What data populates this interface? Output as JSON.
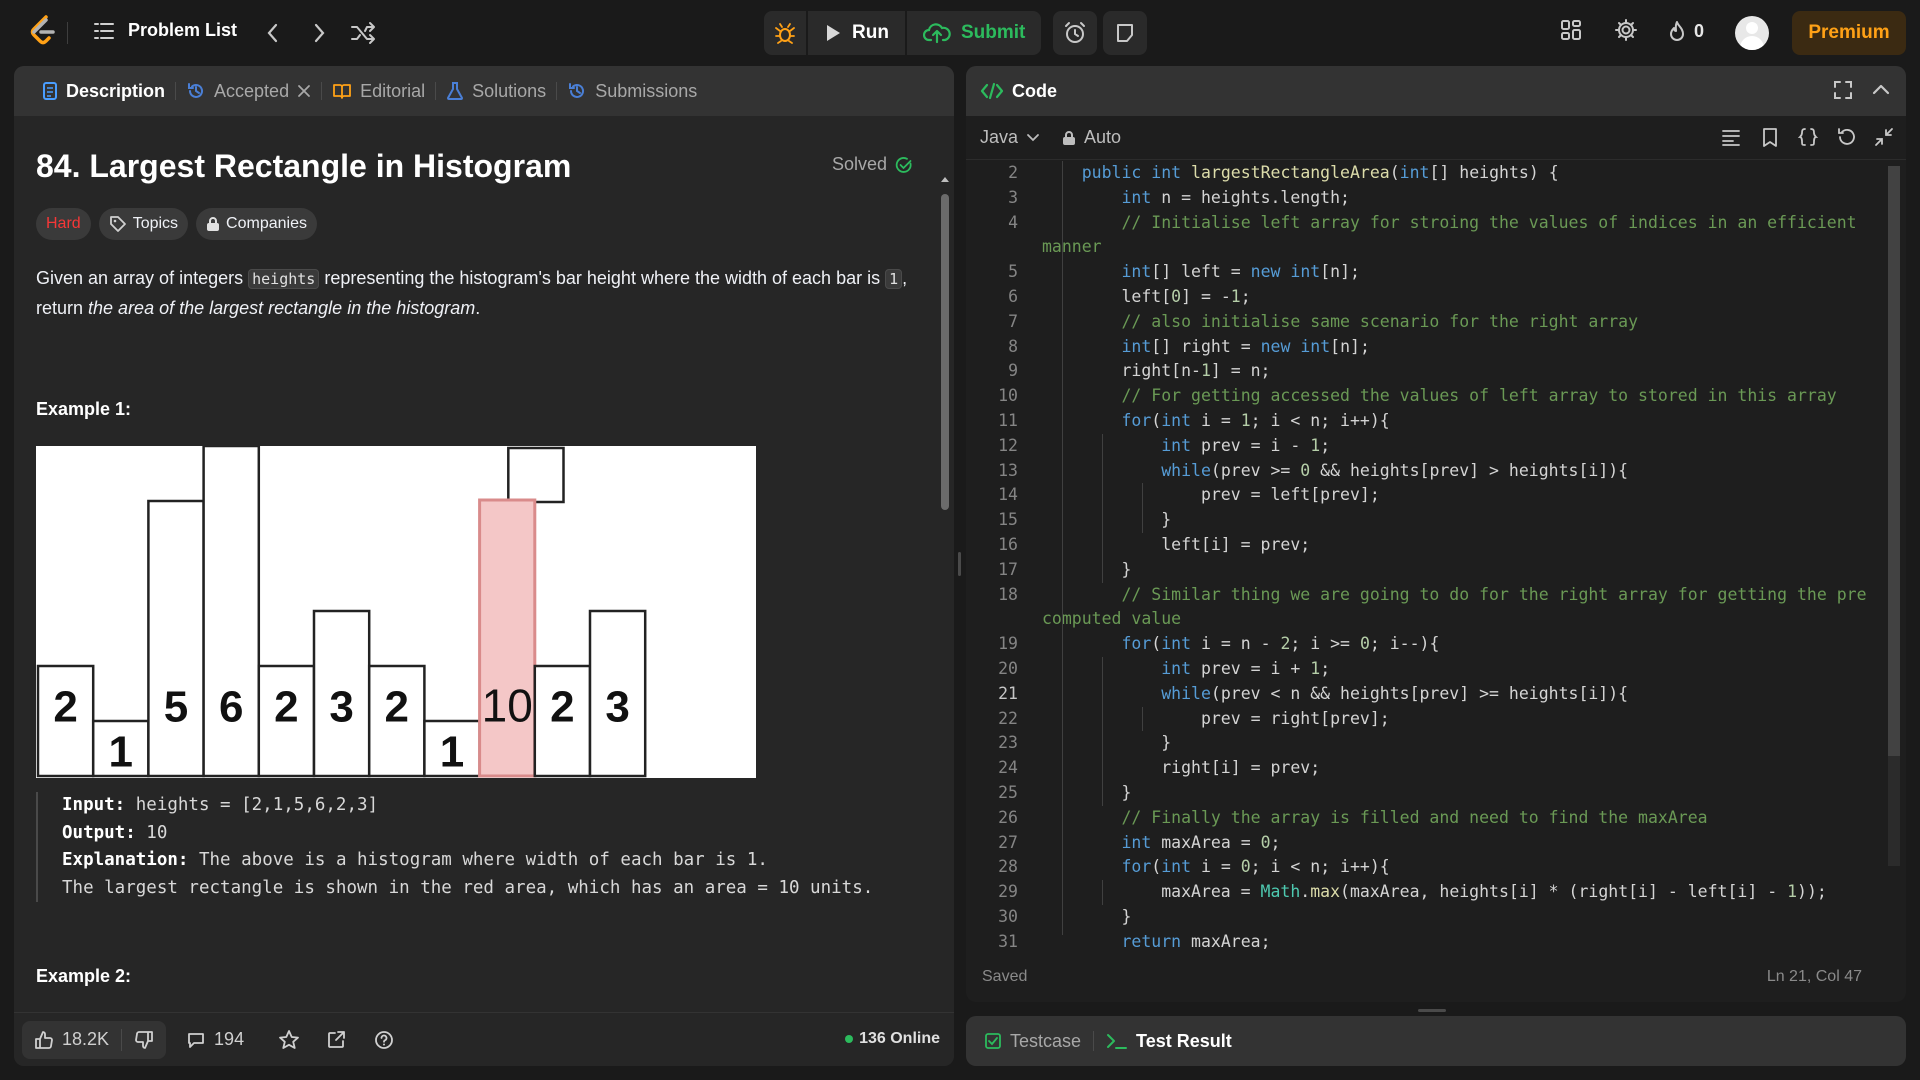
{
  "colors": {
    "accent": "#ffa116",
    "success": "#2cbb5d",
    "hard": "#f63737",
    "highlight": "#f4c7c7"
  },
  "topbar": {
    "problem_list": "Problem List",
    "run": "Run",
    "submit": "Submit",
    "streak": "0",
    "premium": "Premium"
  },
  "left": {
    "tabs": [
      "Description",
      "Accepted",
      "Editorial",
      "Solutions",
      "Submissions"
    ],
    "title": "84. Largest Rectangle in Histogram",
    "status": "Solved",
    "chips": [
      "Hard",
      "Topics",
      "Companies"
    ],
    "desc": {
      "p1": "Given an array of integers ",
      "code1": "heights",
      "p2": " representing the histogram's bar height where the width of each bar is ",
      "code2": "1",
      "p3": ", return ",
      "em": "the area of the largest rectangle in the histogram",
      "p4": "."
    },
    "example1": "Example 1:",
    "example2": "Example 2:",
    "histogram": {
      "bars": [
        2,
        1,
        5,
        6,
        2,
        3,
        2,
        1,
        10,
        2,
        3
      ]
    },
    "ex1": {
      "input_label": "Input:",
      "input": " heights = [2,1,5,6,2,3]",
      "output_label": "Output:",
      "output": " 10",
      "expl_label": "Explanation:",
      "expl": " The above is a histogram where width of each bar is 1.\nThe largest rectangle is shown in the red area, which has an area = 10 units."
    },
    "footer": {
      "likes": "18.2K",
      "comments": "194",
      "online": "136 Online"
    }
  },
  "right": {
    "title": "Code",
    "language": "Java",
    "mode": "Auto",
    "saved": "Saved",
    "cursor": "Ln 21, Col 47",
    "tabs": [
      "Testcase",
      "Test Result"
    ]
  },
  "code_lines": [
    {
      "n": "2",
      "t": "    public int largestRectangleArea(int[] heights) {"
    },
    {
      "n": "3",
      "t": "        int n = heights.length;"
    },
    {
      "n": "4",
      "t": "        // Initialise left array for stroing the values of indices in an efficient"
    },
    {
      "n": "",
      "t": "manner"
    },
    {
      "n": "5",
      "t": "        int[] left = new int[n];"
    },
    {
      "n": "6",
      "t": "        left[0] = -1;"
    },
    {
      "n": "7",
      "t": "        // also initialise same scenario for the right array"
    },
    {
      "n": "8",
      "t": "        int[] right = new int[n];"
    },
    {
      "n": "9",
      "t": "        right[n-1] = n;"
    },
    {
      "n": "10",
      "t": "        // For getting accessed the values of left array to stored in this array"
    },
    {
      "n": "11",
      "t": "        for(int i = 1; i < n; i++){"
    },
    {
      "n": "12",
      "t": "            int prev = i - 1;"
    },
    {
      "n": "13",
      "t": "            while(prev >= 0 && heights[prev] > heights[i]){"
    },
    {
      "n": "14",
      "t": "                prev = left[prev];"
    },
    {
      "n": "15",
      "t": "            }"
    },
    {
      "n": "16",
      "t": "            left[i] = prev;"
    },
    {
      "n": "17",
      "t": "        }"
    },
    {
      "n": "18",
      "t": "        // Similar thing we are going to do for the right array for getting the pre"
    },
    {
      "n": "",
      "t": "computed value"
    },
    {
      "n": "19",
      "t": "        for(int i = n - 2; i >= 0; i--){"
    },
    {
      "n": "20",
      "t": "            int prev = i + 1;"
    },
    {
      "n": "21",
      "t": "            while(prev < n && heights[prev] >= heights[i]){"
    },
    {
      "n": "22",
      "t": "                prev = right[prev];"
    },
    {
      "n": "23",
      "t": "            }"
    },
    {
      "n": "24",
      "t": "            right[i] = prev;"
    },
    {
      "n": "25",
      "t": "        }"
    },
    {
      "n": "26",
      "t": "        // Finally the array is filled and need to find the maxArea"
    },
    {
      "n": "27",
      "t": "        int maxArea = 0;"
    },
    {
      "n": "28",
      "t": "        for(int i = 0; i < n; i++){"
    },
    {
      "n": "29",
      "t": "            maxArea = Math.max(maxArea, heights[i] * (right[i] - left[i] - 1));"
    },
    {
      "n": "30",
      "t": "        }"
    },
    {
      "n": "31",
      "t": "        return maxArea;"
    }
  ]
}
